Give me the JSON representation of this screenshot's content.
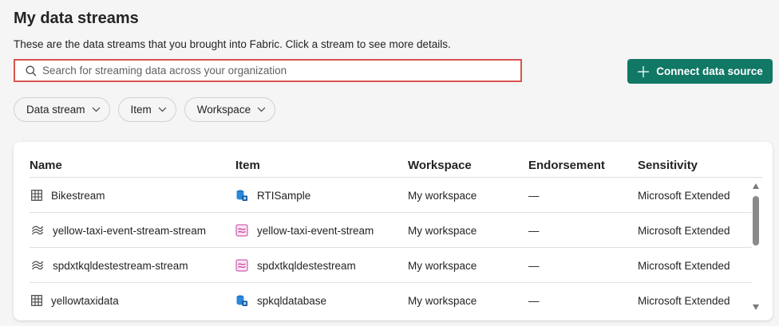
{
  "page": {
    "title": "My data streams",
    "subtitle": "These are the data streams that you brought into Fabric. Click a stream to see more details."
  },
  "search": {
    "placeholder": "Search for streaming data across your organization",
    "value": ""
  },
  "connect_button": {
    "label": "Connect data source",
    "color": "#117865"
  },
  "filters": [
    {
      "label": "Data stream"
    },
    {
      "label": "Item"
    },
    {
      "label": "Workspace"
    }
  ],
  "table": {
    "columns": [
      "Name",
      "Item",
      "Workspace",
      "Endorsement",
      "Sensitivity"
    ],
    "rows": [
      {
        "name": "Bikestream",
        "name_icon": "table-grid-icon",
        "item": "RTISample",
        "item_icon": "kql-database-icon",
        "workspace": "My workspace",
        "endorsement": "—",
        "sensitivity": "Microsoft Extended"
      },
      {
        "name": "yellow-taxi-event-stream-stream",
        "name_icon": "stream-icon",
        "item": "yellow-taxi-event-stream",
        "item_icon": "eventstream-icon",
        "workspace": "My workspace",
        "endorsement": "—",
        "sensitivity": "Microsoft Extended"
      },
      {
        "name": "spdxtkqldestestream-stream",
        "name_icon": "stream-icon",
        "item": "spdxtkqldestestream",
        "item_icon": "eventstream-icon",
        "workspace": "My workspace",
        "endorsement": "—",
        "sensitivity": "Microsoft Extended"
      },
      {
        "name": "yellowtaxidata",
        "name_icon": "table-grid-icon",
        "item": "spkqldatabase",
        "item_icon": "kql-database-icon",
        "workspace": "My workspace",
        "endorsement": "—",
        "sensitivity": "Microsoft Extended"
      }
    ]
  }
}
